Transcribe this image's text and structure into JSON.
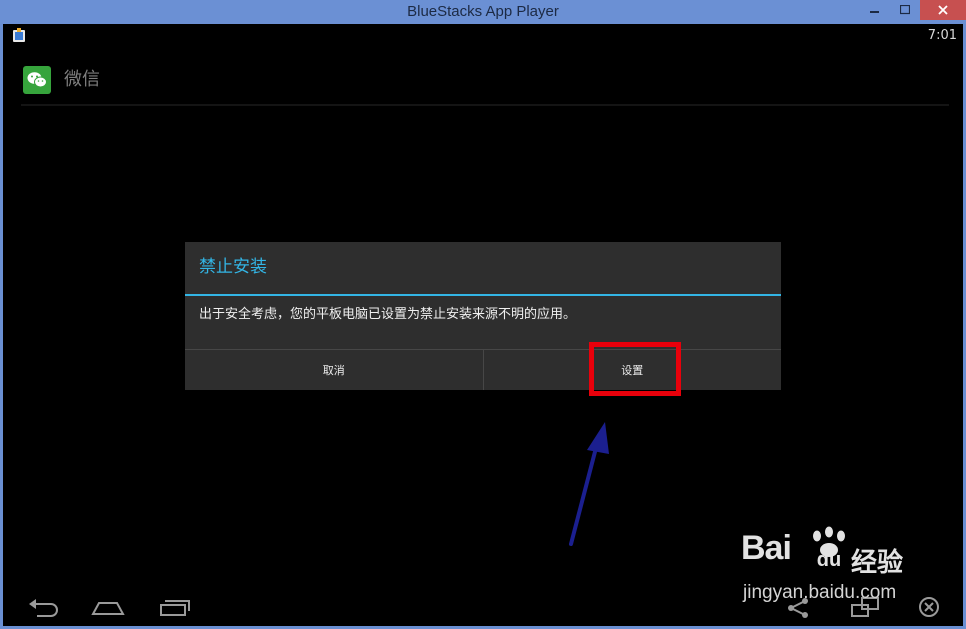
{
  "window": {
    "title": "BlueStacks App Player",
    "controls": [
      "minimize-icon",
      "maximize-icon",
      "close-icon"
    ],
    "frame_color": "#6b90d4",
    "close_color": "#c75050"
  },
  "statusbar": {
    "app_icon": "bluestacks-app-icon",
    "time": "7:01"
  },
  "actionbar": {
    "app_icon": "wechat-icon",
    "app_name": "微信"
  },
  "dialog": {
    "title": "禁止安装",
    "message": "出于安全考虑，您的平板电脑已设置为禁止安装来源不明的应用。",
    "cancel_label": "取消",
    "settings_label": "设置",
    "accent_color": "#33b5e5"
  },
  "annotations": {
    "highlight_color": "#e8000b",
    "arrow_color": "#1b1f8f"
  },
  "navbar": {
    "buttons": [
      "back-icon",
      "home-icon",
      "recent-apps-icon",
      "share-icon",
      "multi-window-icon",
      "close-app-icon"
    ]
  },
  "watermark": {
    "brand": "Bai",
    "brand_suffix": "du",
    "product": "经验",
    "url": "jingyan.baidu.com"
  }
}
